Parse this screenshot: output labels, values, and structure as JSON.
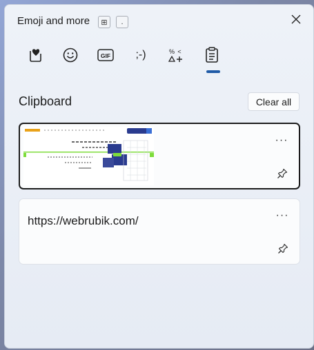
{
  "panel": {
    "title": "Emoji and more",
    "shortcut_keys": [
      {
        "name": "windows-key",
        "glyph": "⊞"
      },
      {
        "name": "period-key",
        "glyph": "."
      }
    ],
    "close_icon": "close-icon"
  },
  "tabs": [
    {
      "name": "tab-emoji",
      "icon": "heart-emoji-icon",
      "label": ""
    },
    {
      "name": "tab-kaomoji",
      "icon": "smiley-icon",
      "label": ""
    },
    {
      "name": "tab-gif",
      "icon": "gif-icon",
      "label": "GIF"
    },
    {
      "name": "tab-emoticon",
      "icon": "emoticon-icon",
      "label": ";-)"
    },
    {
      "name": "tab-symbols",
      "icon": "symbols-icon",
      "label": ""
    },
    {
      "name": "tab-clipboard",
      "icon": "clipboard-icon",
      "label": "",
      "selected": true
    }
  ],
  "clipboard": {
    "title": "Clipboard",
    "clear_all_label": "Clear all",
    "items": [
      {
        "type": "image",
        "description": "website screenshot thumbnail",
        "selected": true,
        "more_label": "···"
      },
      {
        "type": "text",
        "text": "https://webrubik.com/",
        "more_label": "···"
      }
    ]
  },
  "colors": {
    "accent": "#1f5aa6",
    "panel_bg": "#eef2f8",
    "card_bg": "#fbfcfd",
    "thumb_green": "#7ddc3a",
    "thumb_blue": "#2a3b8f"
  }
}
